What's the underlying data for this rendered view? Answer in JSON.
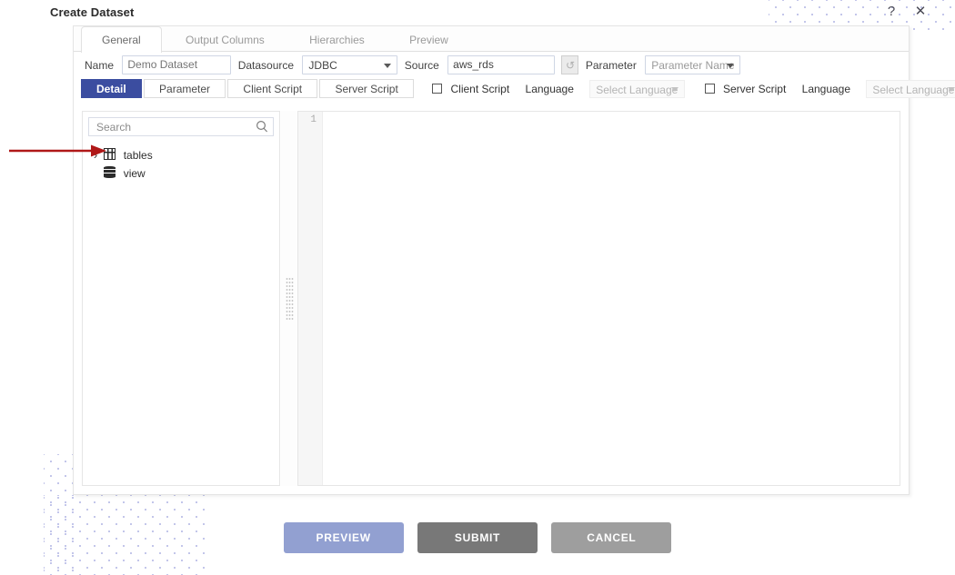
{
  "page_title": "Create Dataset",
  "window_controls": {
    "help": "?",
    "close": "✕"
  },
  "tabs": [
    {
      "label": "General",
      "active": true
    },
    {
      "label": "Output Columns",
      "active": false
    },
    {
      "label": "Hierarchies",
      "active": false
    },
    {
      "label": "Preview",
      "active": false
    }
  ],
  "form": {
    "name_label": "Name",
    "name_value": "Demo Dataset",
    "name_placeholder": "Demo Dataset",
    "datasource_label": "Datasource",
    "datasource_value": "JDBC",
    "source_label": "Source",
    "source_value": "aws_rds",
    "refresh_icon": "refresh-icon",
    "parameter_label": "Parameter",
    "parameter_value": "Parameter Name"
  },
  "subtabs": [
    {
      "label": "Detail",
      "active": true
    },
    {
      "label": "Parameter",
      "active": false
    },
    {
      "label": "Client Script",
      "active": false
    },
    {
      "label": "Server Script",
      "active": false
    }
  ],
  "script_options": {
    "client_script_label": "Client Script",
    "client_language_label": "Language",
    "client_language_value": "Select Language",
    "server_script_label": "Server Script",
    "server_language_label": "Language",
    "server_language_value": "Select Language"
  },
  "tree_panel": {
    "search_placeholder": "Search",
    "search_value": "",
    "search_icon": "search-icon",
    "nodes": [
      {
        "label": "tables",
        "icon": "table-grid-icon",
        "expandable": true,
        "expander": "›"
      },
      {
        "label": "view",
        "icon": "database-icon",
        "expandable": false,
        "expander": ""
      }
    ]
  },
  "editor": {
    "line_numbers": [
      "1"
    ],
    "content": ""
  },
  "footer": {
    "preview_label": "PREVIEW",
    "submit_label": "SUBMIT",
    "cancel_label": "CANCEL"
  },
  "colors": {
    "accent_blue": "#3b4da0",
    "preview_button": "#92a0d1",
    "submit_button": "#787878",
    "cancel_button": "#9e9e9e",
    "annotation_arrow": "#b01818",
    "dot_pattern": "#c3c6ea"
  }
}
